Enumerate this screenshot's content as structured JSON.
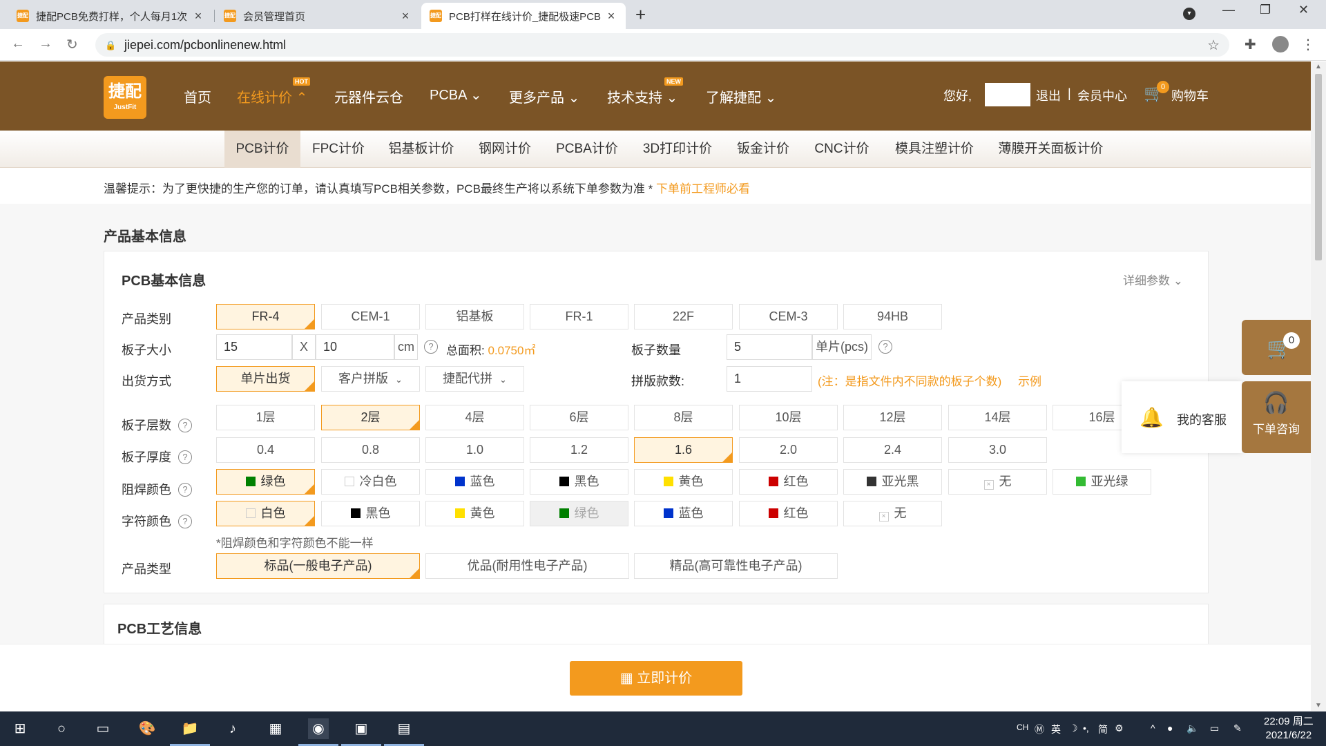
{
  "browser": {
    "tabs": [
      {
        "title": "捷配PCB免费打样，个人每月1次",
        "icon_text": "捷配"
      },
      {
        "title": "会员管理首页",
        "icon_text": "捷配"
      },
      {
        "title": "PCB打样在线计价_捷配极速PCB",
        "icon_text": "捷配"
      }
    ],
    "url": "jiepei.com/pcbonlinenew.html"
  },
  "header": {
    "logo_main": "捷配",
    "logo_sub": "JustFit",
    "nav": [
      {
        "label": "首页"
      },
      {
        "label": "在线计价",
        "badge": "HOT"
      },
      {
        "label": "元器件云仓"
      },
      {
        "label": "PCBA"
      },
      {
        "label": "更多产品"
      },
      {
        "label": "技术支持",
        "badge": "NEW"
      },
      {
        "label": "了解捷配"
      }
    ],
    "greeting": "您好,",
    "logout": "退出",
    "separator": "|",
    "member_center": "会员中心",
    "cart_label": "购物车",
    "cart_count": "0"
  },
  "subnav": [
    "PCB计价",
    "FPC计价",
    "铝基板计价",
    "钢网计价",
    "PCBA计价",
    "3D打印计价",
    "钣金计价",
    "CNC计价",
    "模具注塑计价",
    "薄膜开关面板计价"
  ],
  "tip": {
    "text": "温馨提示：为了更快捷的生产您的订单，请认真填写PCB相关参数，PCB最终生产将以系统下单参数为准 * ",
    "link": "下单前工程师必看"
  },
  "section_title": "产品基本信息",
  "panel": {
    "title": "PCB基本信息",
    "detail_link": "详细参数",
    "rows": {
      "material": {
        "label": "产品类别",
        "options": [
          "FR-4",
          "CEM-1",
          "铝基板",
          "FR-1",
          "22F",
          "CEM-3",
          "94HB"
        ]
      },
      "size": {
        "label": "板子大小",
        "length": "15",
        "x": "X",
        "width": "10",
        "unit": "cm",
        "area_label": "总面积:",
        "area_value": "0.0750㎡"
      },
      "quantity": {
        "label": "板子数量",
        "value": "5",
        "unit": "单片(pcs)"
      },
      "shipping": {
        "label": "出货方式",
        "options": [
          "单片出货",
          "客户拼版",
          "捷配代拼"
        ]
      },
      "panel_count": {
        "label": "拼版款数:",
        "value": "1",
        "note": "(注：是指文件内不同款的板子个数)",
        "example": "示例"
      },
      "layers": {
        "label": "板子层数",
        "options": [
          "1层",
          "2层",
          "4层",
          "6层",
          "8层",
          "10层",
          "12层",
          "14层",
          "16层"
        ]
      },
      "thickness": {
        "label": "板子厚度",
        "options": [
          "0.4",
          "0.8",
          "1.0",
          "1.2",
          "1.6",
          "2.0",
          "2.4",
          "3.0"
        ]
      },
      "solder_mask": {
        "label": "阻焊颜色",
        "options": [
          {
            "name": "绿色",
            "color": "#008000"
          },
          {
            "name": "冷白色",
            "color": "#ffffff"
          },
          {
            "name": "蓝色",
            "color": "#0033cc"
          },
          {
            "name": "黑色",
            "color": "#000000"
          },
          {
            "name": "黄色",
            "color": "#ffe000"
          },
          {
            "name": "红色",
            "color": "#cc0000"
          },
          {
            "name": "亚光黑",
            "color": "#333333"
          },
          {
            "name": "无",
            "color": "none"
          },
          {
            "name": "亚光绿",
            "color": "#33bb33"
          }
        ]
      },
      "silkscreen": {
        "label": "字符颜色",
        "options": [
          {
            "name": "白色",
            "color": "#ffffff"
          },
          {
            "name": "黑色",
            "color": "#000000"
          },
          {
            "name": "黄色",
            "color": "#ffe000"
          },
          {
            "name": "绿色",
            "color": "#008000"
          },
          {
            "name": "蓝色",
            "color": "#0033cc"
          },
          {
            "name": "红色",
            "color": "#cc0000"
          },
          {
            "name": "无",
            "color": "none"
          }
        ]
      },
      "color_note": "*阻焊颜色和字符颜色不能一样",
      "product_type": {
        "label": "产品类型",
        "options": [
          "标品(一般电子产品)",
          "优品(耐用性电子产品)",
          "精品(高可靠性电子产品)"
        ]
      }
    }
  },
  "panel2_title": "PCB工艺信息",
  "float": {
    "cart_count": "0",
    "service_label": "我的客服",
    "consult_label": "下单咨询"
  },
  "quote_button": "立即计价",
  "taskbar": {
    "tray_lang": "CH",
    "ime_1": "英",
    "ime_2": "简",
    "time": "22:09 周二",
    "date": "2021/6/22"
  },
  "colors": {
    "brand_brown": "#7b5426",
    "accent_orange": "#f39a1e",
    "float_brown": "#a5773f"
  }
}
